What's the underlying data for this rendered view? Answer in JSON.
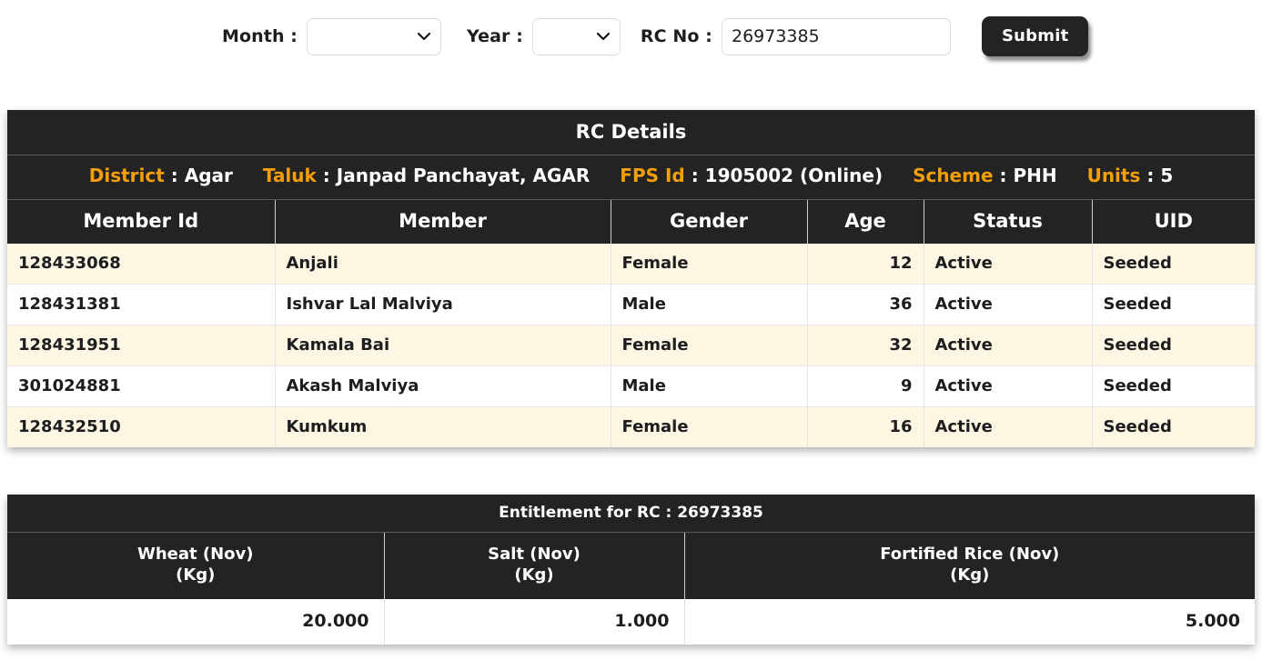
{
  "filters": {
    "month_label": "Month :",
    "month_value": "",
    "month_options": [
      ""
    ],
    "year_label": "Year :",
    "year_value": "",
    "year_options": [
      ""
    ],
    "rcno_label": "RC No :",
    "rcno_value": "26973385",
    "rcno_placeholder": "",
    "submit_label": "Submit"
  },
  "rc_panel": {
    "title": "RC Details",
    "meta": [
      {
        "key": "District",
        "sep": " : ",
        "value": "Agar"
      },
      {
        "key": "Taluk",
        "sep": " : ",
        "value": "Janpad Panchayat, AGAR"
      },
      {
        "key": "FPS Id",
        "sep": " : ",
        "value": "1905002 (Online)"
      },
      {
        "key": "Scheme",
        "sep": " : ",
        "value": "PHH"
      },
      {
        "key": "Units",
        "sep": " : ",
        "value": "5"
      }
    ],
    "columns": [
      "Member Id",
      "Member",
      "Gender",
      "Age",
      "Status",
      "UID"
    ],
    "rows": [
      {
        "member_id": "128433068",
        "member": "Anjali",
        "gender": "Female",
        "age": "12",
        "status": "Active",
        "uid": "Seeded"
      },
      {
        "member_id": "128431381",
        "member": "Ishvar Lal Malviya",
        "gender": "Male",
        "age": "36",
        "status": "Active",
        "uid": "Seeded"
      },
      {
        "member_id": "128431951",
        "member": "Kamala Bai",
        "gender": "Female",
        "age": "32",
        "status": "Active",
        "uid": "Seeded"
      },
      {
        "member_id": "301024881",
        "member": "Akash Malviya",
        "gender": "Male",
        "age": "9",
        "status": "Active",
        "uid": "Seeded"
      },
      {
        "member_id": "128432510",
        "member": "Kumkum",
        "gender": "Female",
        "age": "16",
        "status": "Active",
        "uid": "Seeded"
      }
    ]
  },
  "entitlement_panel": {
    "title": "Entitlement for RC : 26973385",
    "columns": [
      {
        "name": "Wheat (Nov)",
        "unit": "(Kg)"
      },
      {
        "name": "Salt (Nov)",
        "unit": "(Kg)"
      },
      {
        "name": "Fortified Rice (Nov)",
        "unit": "(Kg)"
      }
    ],
    "values": [
      "20.000",
      "1.000",
      "5.000"
    ]
  },
  "colors": {
    "panel_header_bg": "#232323",
    "accent_label": "#f59e0b",
    "row_alt_bg": "#fdf6e3",
    "page_bg": "#ffffff"
  },
  "icons": {
    "chevron_down": "chevron-down-icon"
  }
}
